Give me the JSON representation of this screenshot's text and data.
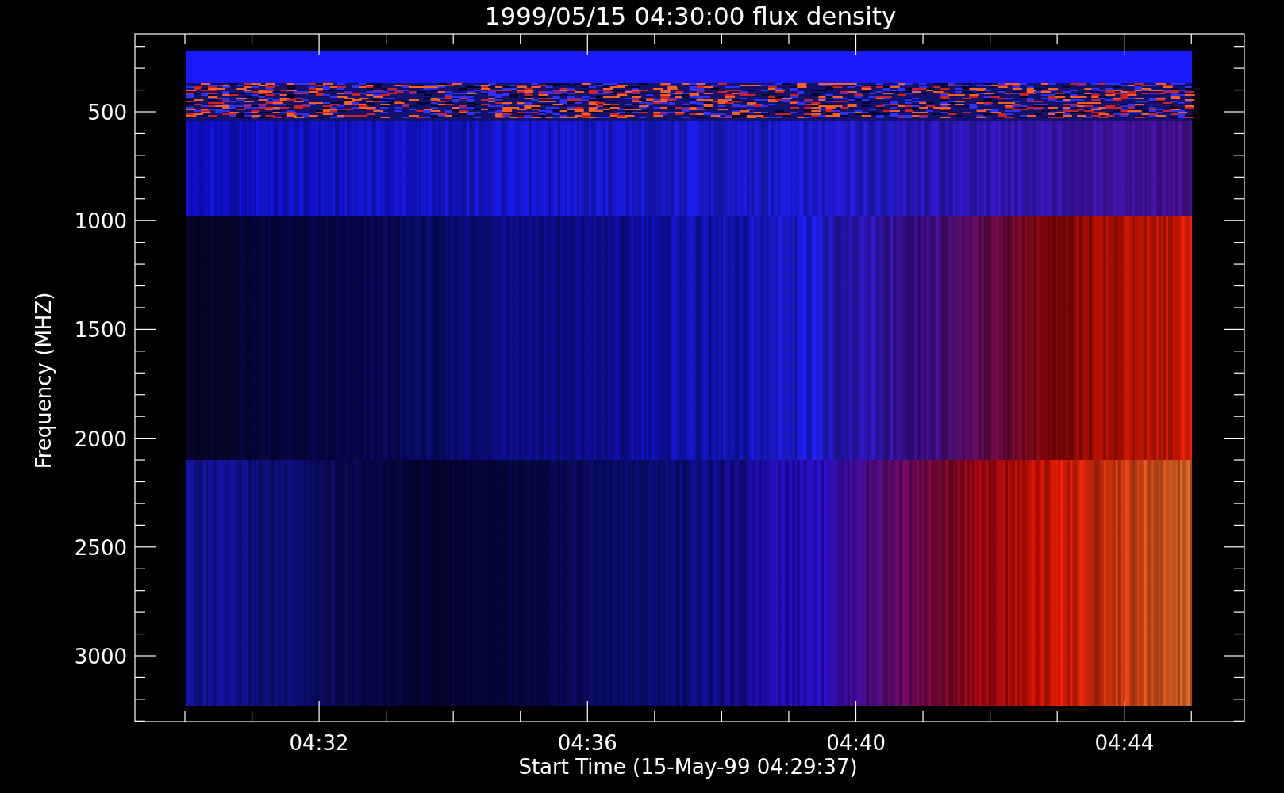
{
  "title": "1999/05/15 04:30:00 flux density",
  "y_axis": {
    "label": "Frequency (MHZ)",
    "ticks": [
      "500",
      "1000",
      "1500",
      "2000",
      "2500",
      "3000"
    ]
  },
  "x_axis": {
    "label": "Start Time (15-May-99 04:29:37)",
    "ticks": [
      "04:32",
      "04:36",
      "04:40",
      "04:44"
    ]
  }
}
